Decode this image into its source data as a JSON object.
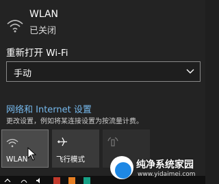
{
  "wlan": {
    "name": "WLAN",
    "status": "已关闭"
  },
  "reopen": {
    "label": "重新打开 Wi-Fi",
    "selected": "手动"
  },
  "network_settings": {
    "link": "网络和 Internet 设置",
    "description": "更改设置，例如将某连接设置为按流量计费。"
  },
  "quick_actions": [
    {
      "label": "WLAN",
      "icon": "wifi-icon",
      "state": "off"
    },
    {
      "label": "飞行模式",
      "icon": "airplane-icon",
      "state": "off"
    },
    {
      "label": "",
      "icon": "mobile-hotspot-icon",
      "state": "disabled"
    }
  ],
  "watermark": {
    "title": "纯净系统家园",
    "url": "www.yidaimei.com"
  },
  "colors": {
    "accent_link": "#76b9ed",
    "background": "#232323",
    "tile": "#3a3a3a"
  }
}
